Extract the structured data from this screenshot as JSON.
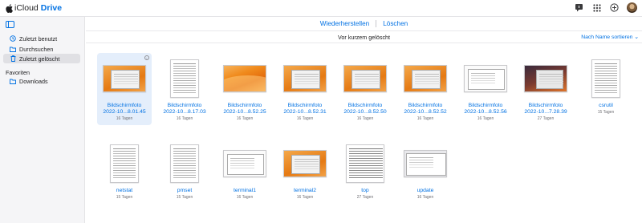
{
  "app": {
    "brand": "iCloud",
    "product": "Drive"
  },
  "header_icons": [
    "notes-icon",
    "apps-grid-icon",
    "add-icon",
    "avatar"
  ],
  "sidebar": {
    "items": [
      {
        "label": "Zuletzt benutzt",
        "icon": "clock-icon"
      },
      {
        "label": "Durchsuchen",
        "icon": "folder-icon"
      },
      {
        "label": "Zuletzt gelöscht",
        "icon": "trash-icon"
      }
    ],
    "favorites_title": "Favoriten",
    "favorites": [
      {
        "label": "Downloads",
        "icon": "folder-icon"
      }
    ]
  },
  "toolbar": {
    "restore": "Wiederherstellen",
    "delete": "Löschen"
  },
  "view": {
    "title": "Vor kurzem gelöscht",
    "sort": "Nach Name sortieren"
  },
  "files": [
    {
      "name": "Bildschirmfoto",
      "name2": "2022-10...8.01.45",
      "age": "16 Tagen",
      "thumb": "desktop",
      "selected": true
    },
    {
      "name": "Bildschirmfoto",
      "name2": "2022-10...8.17.03",
      "age": "16 Tagen",
      "thumb": "doc"
    },
    {
      "name": "Bildschirmfoto",
      "name2": "2022-10...8.52.25",
      "age": "16 Tagen",
      "thumb": "ventura"
    },
    {
      "name": "Bildschirmfoto",
      "name2": "2022-10...8.52.31",
      "age": "16 Tagen",
      "thumb": "desktop"
    },
    {
      "name": "Bildschirmfoto",
      "name2": "2022-10...8.52.50",
      "age": "16 Tagen",
      "thumb": "desktop"
    },
    {
      "name": "Bildschirmfoto",
      "name2": "2022-10...8.52.52",
      "age": "16 Tagen",
      "thumb": "desktop"
    },
    {
      "name": "Bildschirmfoto",
      "name2": "2022-10...8.52.56",
      "age": "16 Tagen",
      "thumb": "white"
    },
    {
      "name": "Bildschirmfoto",
      "name2": "2022-10...7.28.39",
      "age": "27 Tagen",
      "thumb": "dark"
    },
    {
      "name": "csrutil",
      "name2": "",
      "age": "15 Tagen",
      "thumb": "doc"
    },
    {
      "name": "netstat",
      "name2": "",
      "age": "15 Tagen",
      "thumb": "doc"
    },
    {
      "name": "pmset",
      "name2": "",
      "age": "15 Tagen",
      "thumb": "doc"
    },
    {
      "name": "terminal1",
      "name2": "",
      "age": "16 Tagen",
      "thumb": "white"
    },
    {
      "name": "terminal2",
      "name2": "",
      "age": "16 Tagen",
      "thumb": "desktop"
    },
    {
      "name": "top",
      "name2": "",
      "age": "27 Tagen",
      "thumb": "sheet"
    },
    {
      "name": "update",
      "name2": "",
      "age": "16 Tagen",
      "thumb": "grey"
    }
  ],
  "colors": {
    "accent": "#0071e3",
    "sidebar_bg": "#f5f5f7",
    "selected_bg": "#e4eefb"
  }
}
